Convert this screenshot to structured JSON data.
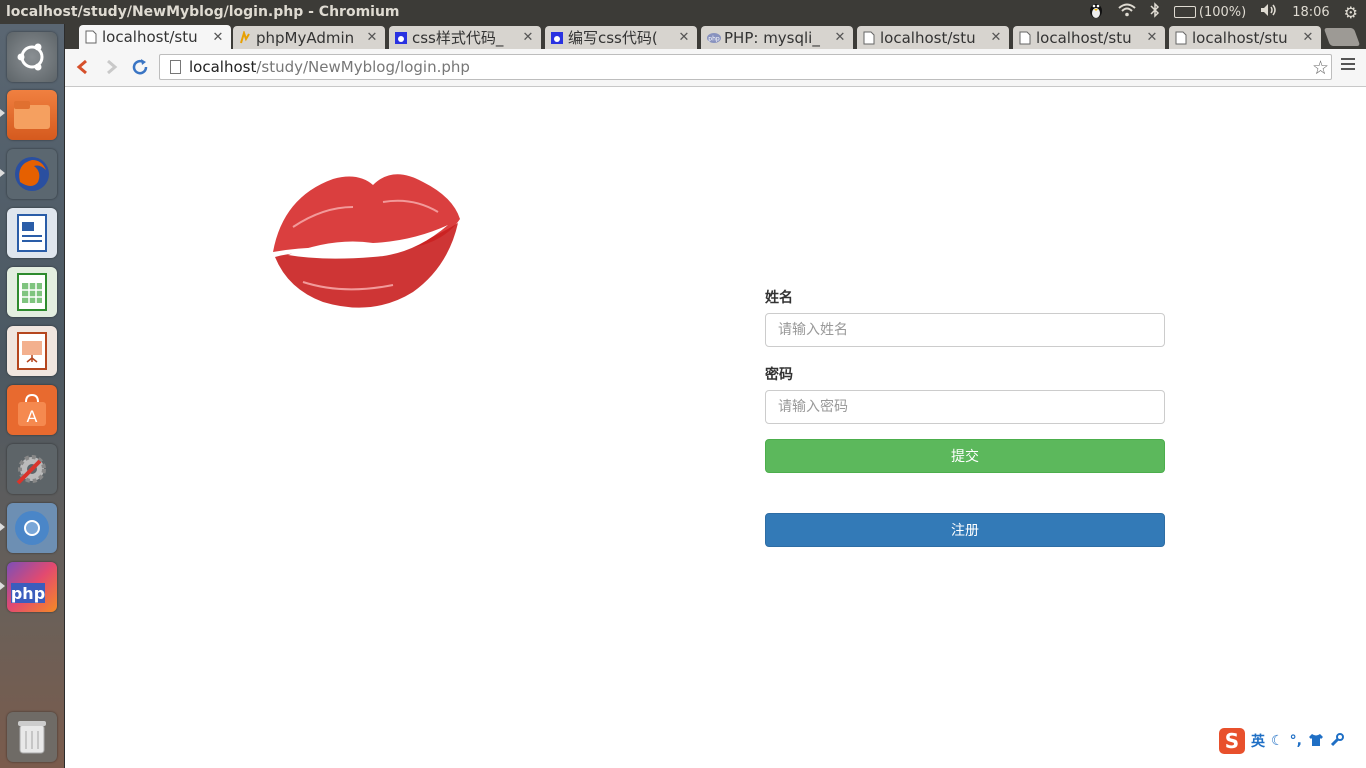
{
  "window": {
    "title": "localhost/study/NewMyblog/login.php - Chromium",
    "battery": "(100%)",
    "clock": "18:06"
  },
  "launcher": {
    "items": [
      "ubuntu-dash",
      "files",
      "firefox",
      "writer",
      "calc",
      "impress",
      "software-center",
      "system-settings",
      "chromium",
      "phpstorm",
      "trash"
    ]
  },
  "tabs": [
    {
      "label": "localhost/stu",
      "icon": "page-icon",
      "active": true
    },
    {
      "label": "phpMyAdmin",
      "icon": "pma-icon"
    },
    {
      "label": "css样式代码_",
      "icon": "baidu-icon"
    },
    {
      "label": "编写css代码(",
      "icon": "baidu-icon"
    },
    {
      "label": "PHP: mysqli_",
      "icon": "php-icon"
    },
    {
      "label": "localhost/stu",
      "icon": "page-icon"
    },
    {
      "label": "localhost/stu",
      "icon": "page-icon"
    },
    {
      "label": "localhost/stu",
      "icon": "page-icon"
    }
  ],
  "address": {
    "host": "localhost",
    "path": "/study/NewMyblog/login.php"
  },
  "form": {
    "name_label": "姓名",
    "name_placeholder": "请输入姓名",
    "password_label": "密码",
    "password_placeholder": "请输入密码",
    "submit_label": "提交",
    "register_label": "注册"
  },
  "ime": {
    "mode": "英"
  }
}
